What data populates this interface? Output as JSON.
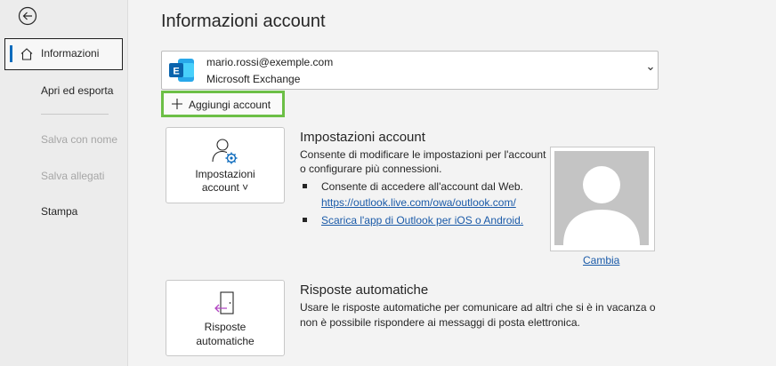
{
  "sidebar": {
    "items": [
      {
        "label": "Informazioni"
      },
      {
        "label": "Apri ed esporta"
      },
      {
        "label": "Salva con nome"
      },
      {
        "label": "Salva allegati"
      },
      {
        "label": "Stampa"
      }
    ]
  },
  "page": {
    "title": "Informazioni account"
  },
  "account": {
    "email": "mario.rossi@exemple.com",
    "type": "Microsoft Exchange",
    "add_label": "Aggiungi account"
  },
  "account_settings": {
    "button_line1": "Impostazioni",
    "button_line2": "account ˅",
    "title": "Impostazioni account",
    "desc_line1": "Consente di modificare le impostazioni per l'account",
    "desc_line2": "o configurare più connessioni.",
    "bullet1_text": "Consente di accedere all'account dal Web.",
    "bullet1_link": "https://outlook.live.com/owa/outlook.com/",
    "bullet2_link": "Scarica l'app di Outlook per iOS o Android.",
    "change_photo": "Cambia"
  },
  "auto_replies": {
    "button_line1": "Risposte",
    "button_line2": "automatiche",
    "title": "Risposte automatiche",
    "desc_line1": "Usare le risposte automatiche per comunicare ad altri che si è in vacanza o",
    "desc_line2": "non è possibile rispondere ai messaggi di posta elettronica."
  },
  "colors": {
    "accent": "#0f6cbd",
    "highlight_border": "#6cbf46",
    "link": "#1a5aa8"
  },
  "icons": [
    "back-arrow-icon",
    "home-icon",
    "exchange-logo-icon",
    "chevron-down-icon",
    "plus-icon",
    "account-settings-icon",
    "auto-replies-icon",
    "profile-photo-placeholder"
  ]
}
